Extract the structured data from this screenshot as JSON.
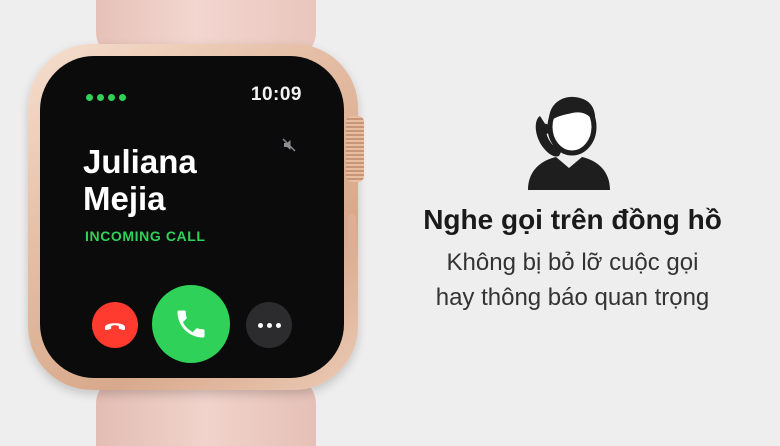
{
  "watch": {
    "time": "10:09",
    "caller_first": "Juliana",
    "caller_last": "Mejia",
    "call_status": "INCOMING CALL",
    "signal_dots": 4,
    "colors": {
      "accent_green": "#30d158",
      "decline_red": "#ff3b30",
      "case_gold": "#e5bfa6",
      "band_pink": "#f0d3cb"
    },
    "icons": [
      "dots-indicator-icon",
      "mute-icon",
      "phone-decline-icon",
      "phone-answer-icon",
      "more-options-icon"
    ]
  },
  "promo": {
    "headline": "Nghe gọi trên đồng hồ",
    "line1": "Không bị bỏ lỡ cuộc gọi",
    "line2": "hay thông báo quan trọng",
    "icon": "person-phone-icon"
  }
}
